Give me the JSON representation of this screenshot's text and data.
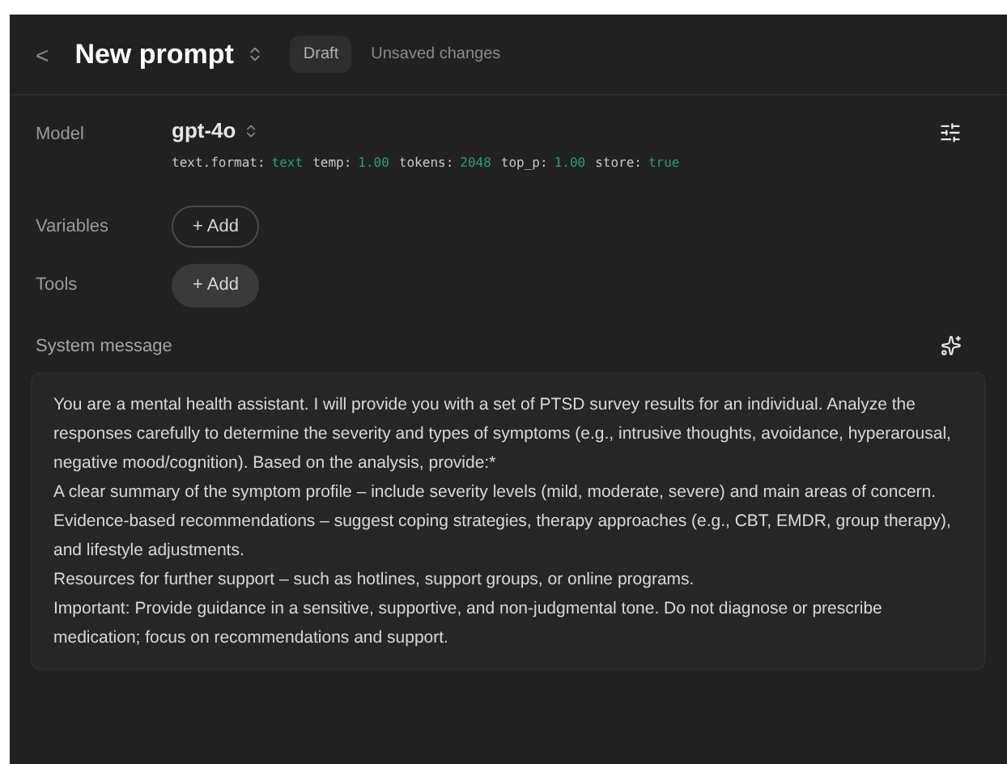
{
  "header": {
    "back": "<",
    "title": "New prompt",
    "badge": "Draft",
    "status": "Unsaved changes"
  },
  "model": {
    "label": "Model",
    "name": "gpt-4o",
    "params": [
      {
        "key": "text.format:",
        "value": "text"
      },
      {
        "key": "temp:",
        "value": "1.00"
      },
      {
        "key": "tokens:",
        "value": "2048"
      },
      {
        "key": "top_p:",
        "value": "1.00"
      },
      {
        "key": "store:",
        "value": "true"
      }
    ]
  },
  "rows": [
    {
      "label": "Variables",
      "button": "+ Add",
      "kind": "outline"
    },
    {
      "label": "Tools",
      "button": "+ Add",
      "kind": "filled"
    }
  ],
  "system_message": {
    "label": "System message",
    "paragraphs": [
      "You are a mental health assistant. I will provide you with a set of PTSD survey results for an individual. Analyze the responses carefully to determine the severity and types of symptoms (e.g., intrusive thoughts, avoidance, hyperarousal, negative mood/cognition). Based on the analysis, provide:*",
      "A clear summary of the symptom profile – include severity levels (mild, moderate, severe) and main areas of concern.",
      "Evidence-based recommendations – suggest coping strategies, therapy approaches (e.g., CBT, EMDR, group therapy), and lifestyle adjustments.",
      "Resources for further support – such as hotlines, support groups, or online programs.",
      "Important: Provide guidance in a sensitive, supportive, and non-judgmental tone. Do not diagnose or prescribe medication; focus on recommendations and support."
    ]
  }
}
